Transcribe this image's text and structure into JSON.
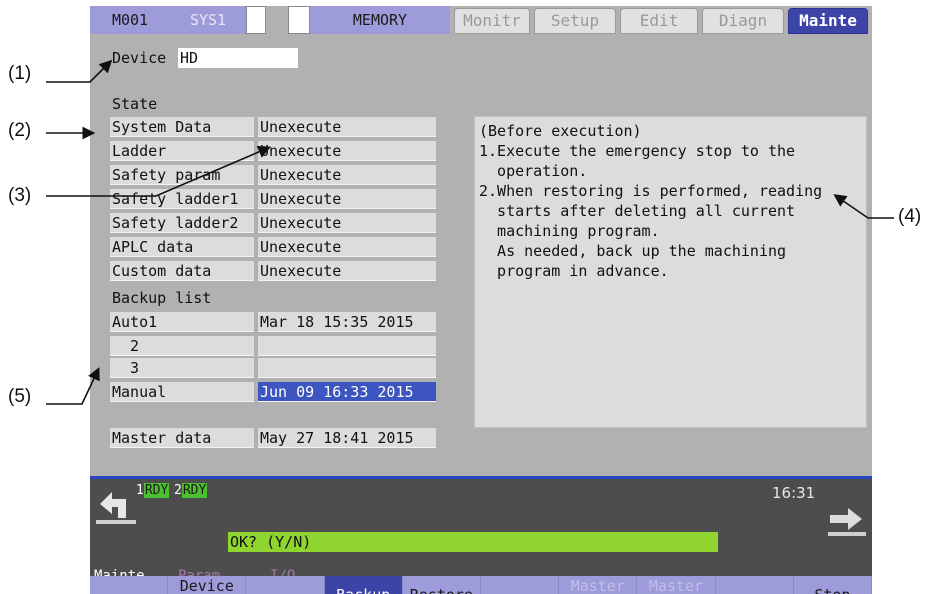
{
  "callouts": [
    "(1)",
    "(2)",
    "(3)",
    "(4)",
    "(5)"
  ],
  "status_bar": {
    "program": "M001",
    "system": "SYS1",
    "mode": "MEMORY",
    "tabs": [
      {
        "label": "Monitr",
        "active": false
      },
      {
        "label": "Setup",
        "active": false
      },
      {
        "label": "Edit",
        "active": false
      },
      {
        "label": "Diagn",
        "active": false
      },
      {
        "label": "Mainte",
        "active": true
      }
    ]
  },
  "device": {
    "label": "Device",
    "value": "HD"
  },
  "state": {
    "heading": "State",
    "rows": [
      {
        "name": "System Data",
        "status": "Unexecute"
      },
      {
        "name": "Ladder",
        "status": "Unexecute"
      },
      {
        "name": "Safety param",
        "status": "Unexecute"
      },
      {
        "name": "Safety ladder1",
        "status": "Unexecute"
      },
      {
        "name": "Safety ladder2",
        "status": "Unexecute"
      },
      {
        "name": "APLC data",
        "status": "Unexecute"
      },
      {
        "name": "Custom data",
        "status": "Unexecute"
      }
    ]
  },
  "backup_list": {
    "heading": "Backup list",
    "rows": [
      {
        "name": "Auto1",
        "date": "Mar 18 15:35 2015",
        "selected": false
      },
      {
        "name": "  2",
        "date": "",
        "selected": false
      },
      {
        "name": "  3",
        "date": "",
        "selected": false
      },
      {
        "name": "Manual",
        "date": "Jun 09 16:33 2015",
        "selected": true
      }
    ],
    "master": {
      "name": "Master data",
      "date": "May 27 18:41 2015"
    }
  },
  "message_panel": {
    "lines": [
      "(Before execution)",
      "1.Execute the emergency stop to the",
      "  operation.",
      "2.When restoring is performed, reading",
      "  starts after deleting all current",
      "  machining program.",
      "  As needed, back up the machining",
      "  program in advance."
    ]
  },
  "bottom": {
    "rdy": [
      {
        "num": "1",
        "tag": "RDY"
      },
      {
        "num": "2",
        "tag": "RDY"
      }
    ],
    "prompt": "OK? (Y/N)",
    "clock": "16:31",
    "menu_title": "Mainte",
    "menu_items": [
      "Param",
      "I/O"
    ]
  },
  "softkeys": [
    {
      "label": "",
      "state": "normal"
    },
    {
      "label": "Device\nselect",
      "state": "normal"
    },
    {
      "label": "",
      "state": "normal"
    },
    {
      "label": "Backup",
      "state": "active"
    },
    {
      "label": "Restore",
      "state": "normal"
    },
    {
      "label": "",
      "state": "normal"
    },
    {
      "label": "Master\nBackup",
      "state": "disabled"
    },
    {
      "label": "Master\nRestore",
      "state": "disabled"
    },
    {
      "label": "",
      "state": "normal"
    },
    {
      "label": "Stop",
      "state": "normal"
    }
  ],
  "colors": {
    "active_tab": "#3d44a8",
    "selection": "#3c55c0",
    "prompt_bg": "#8fd42f",
    "rdy": "#4cc02e"
  }
}
